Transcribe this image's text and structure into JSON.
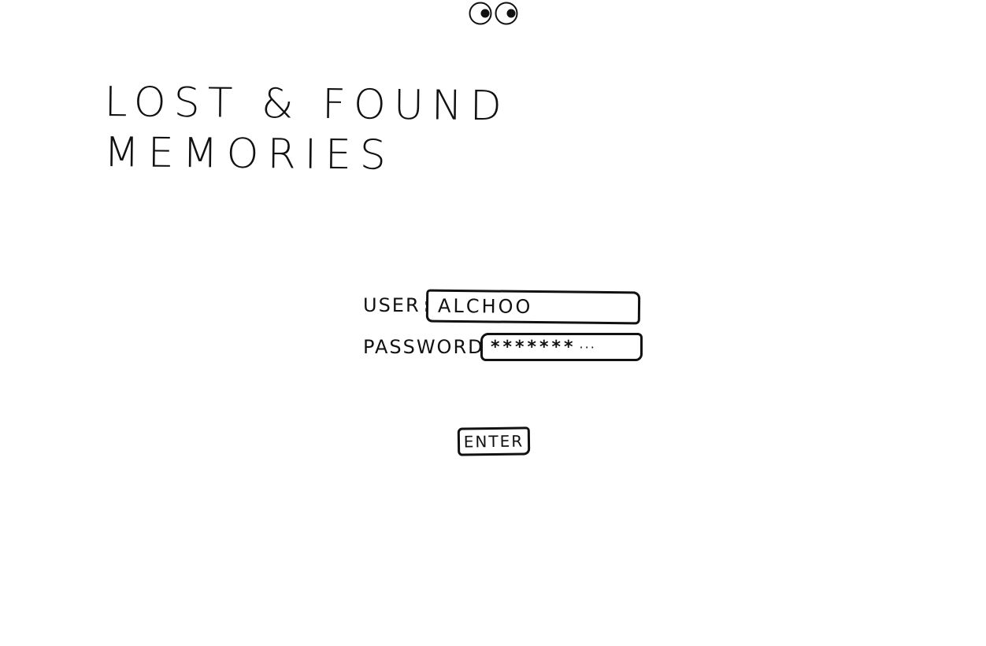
{
  "header": {
    "eyes_icon": "googly-eyes-icon"
  },
  "title": {
    "line1": "LOST & FOUND",
    "line2": "MEMORIES"
  },
  "login": {
    "user_label": "USER",
    "user_value": "ALCHOO",
    "password_label": "PASSWORD",
    "password_value": "*******",
    "password_trailing": "···",
    "label_separator": ":",
    "enter_label": "ENTER"
  },
  "colors": {
    "ink": "#111111",
    "background": "#ffffff"
  }
}
